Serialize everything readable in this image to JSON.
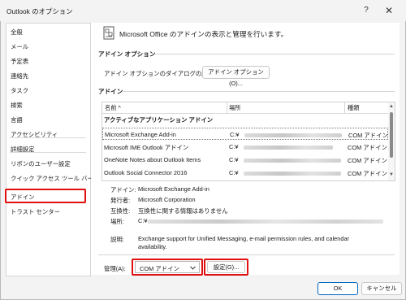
{
  "window": {
    "title": "Outlook のオプション",
    "help_glyph": "?",
    "close_glyph": "✕"
  },
  "sidebar": {
    "items": [
      {
        "label": "全般"
      },
      {
        "label": "メール"
      },
      {
        "label": "予定表"
      },
      {
        "label": "連絡先"
      },
      {
        "label": "タスク"
      },
      {
        "label": "検索"
      },
      {
        "label": "言語"
      },
      {
        "label": "アクセシビリティ"
      },
      {
        "label": "詳細設定"
      },
      {
        "label": "リボンのユーザー設定"
      },
      {
        "label": "クイック アクセス ツール バー"
      },
      {
        "label": "アドイン"
      },
      {
        "label": "トラスト センター"
      }
    ],
    "selected": "アドイン"
  },
  "main": {
    "header": "Microsoft Office のアドインの表示と管理を行います。",
    "addin_options_section": "アドイン オプション",
    "addin_options_label": "アドイン オプションのダイアログの起動:",
    "addin_options_button": "アドイン オプション(O)...",
    "addins_section": "アドイン",
    "table": {
      "columns": [
        "名前 ^",
        "場所",
        "種類"
      ],
      "group": "アクティブなアプリケーション アドイン",
      "rows": [
        {
          "name": "Microsoft Exchange Add-in",
          "location": "C:¥",
          "type": "COM アドイン",
          "selected": true
        },
        {
          "name": "Microsoft IME Outlook アドイン",
          "location": "C:¥",
          "type": "COM アドイン"
        },
        {
          "name": "OneNote Notes about Outlook Items",
          "location": "C:¥",
          "type": "COM アドイン"
        },
        {
          "name": "Outlook Social Connector 2016",
          "location": "C:¥",
          "type": "COM アドイン"
        }
      ],
      "scroll_up": "▲",
      "scroll_down": "▼"
    },
    "details": {
      "addin_label": "アドイン:",
      "addin_value": "Microsoft Exchange Add-in",
      "publisher_label": "発行者:",
      "publisher_value": "Microsoft Corporation",
      "compat_label": "互換性:",
      "compat_value": "互換性に関する情報はありません",
      "location_label": "場所:",
      "location_value": "C:¥",
      "description_label": "説明:",
      "description_line1": "Exchange support for Unified Messaging, e-mail permission rules, and calendar",
      "description_line2": "availability."
    },
    "manage_label": "管理(A):",
    "manage_select_value": "COM アドイン",
    "settings_button": "設定(G)..."
  },
  "footer": {
    "ok": "OK",
    "cancel": "キャンセル"
  },
  "colors": {
    "highlight_red": "#e01010",
    "ok_border": "#0067c0"
  }
}
